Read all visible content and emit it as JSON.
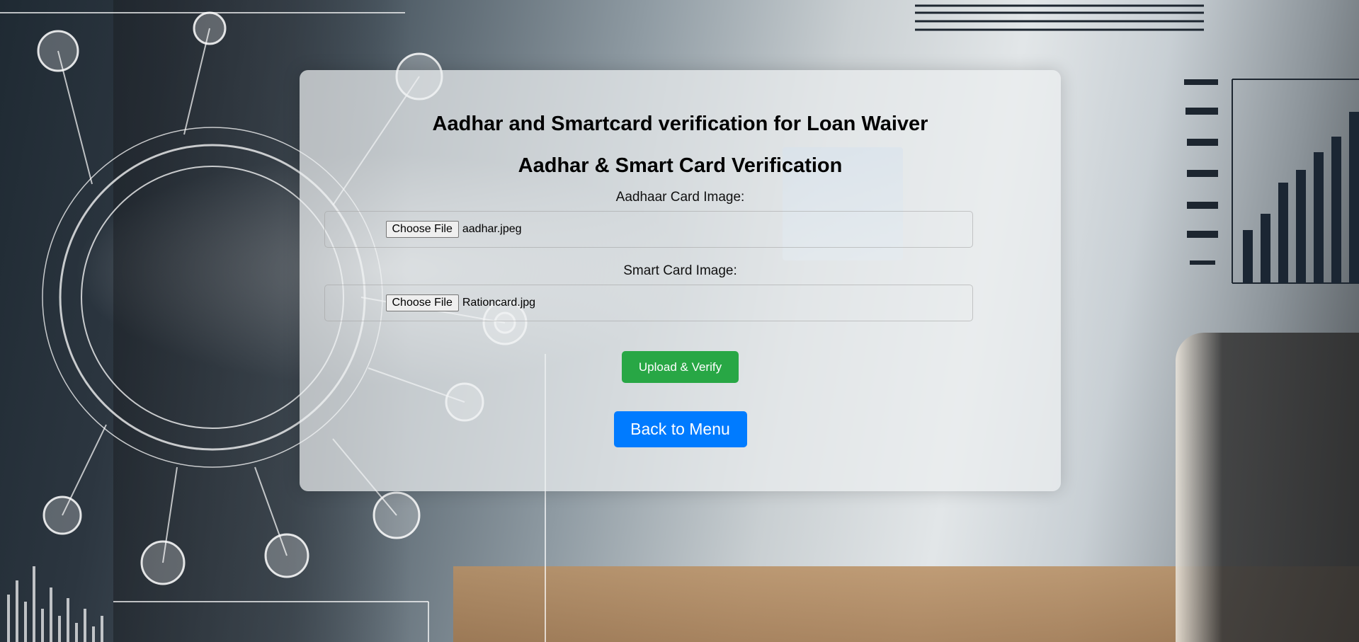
{
  "page": {
    "heading": "Aadhar and Smartcard verification for Loan Waiver",
    "subheading": "Aadhar & Smart Card Verification"
  },
  "form": {
    "aadhaar": {
      "label": "Aadhaar Card Image:",
      "button_label": "Choose File",
      "file_name": "aadhar.jpeg"
    },
    "smartcard": {
      "label": "Smart Card Image:",
      "button_label": "Choose File",
      "file_name": "Rationcard.jpg"
    },
    "submit_label": "Upload & Verify"
  },
  "nav": {
    "back_label": "Back to Menu"
  },
  "colors": {
    "submit": "#28a745",
    "back": "#007bff"
  }
}
